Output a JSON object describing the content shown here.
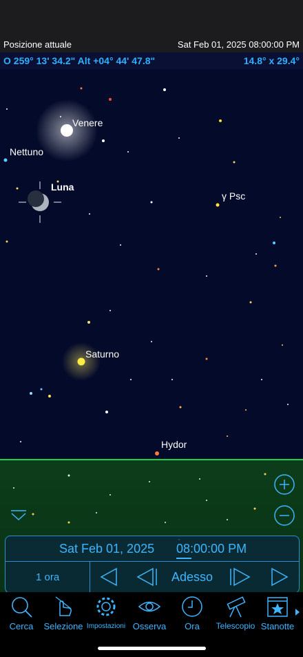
{
  "info": {
    "location": "Posizione attuale",
    "datetime": "Sat Feb 01, 2025  08:00:00 PM"
  },
  "coords": {
    "position": "O 259° 13' 34.2\" Alt +04° 44' 47.8\"",
    "fov": "14.8° x 29.4°"
  },
  "sky_labels": {
    "venus": "Venere",
    "neptune": "Nettuno",
    "moon": "Luna",
    "gamma_psc": "γ Psc",
    "saturn": "Saturno",
    "hydor": "Hydor"
  },
  "time_panel": {
    "date": "Sat Feb 01, 2025",
    "time": "08:00:00 PM",
    "step": "1 ora",
    "now": "Adesso"
  },
  "toolbar": {
    "search": "Cerca",
    "selection": "Selezione",
    "settings": "Impostazioni",
    "observe": "Osserva",
    "time": "Ora",
    "telescope": "Telescopio",
    "tonight": "Stanotte"
  },
  "colors": {
    "accent": "#3db6ff",
    "sky": "#040a2a",
    "horizon": "#22d04a",
    "ground": "#0c3d1a"
  }
}
